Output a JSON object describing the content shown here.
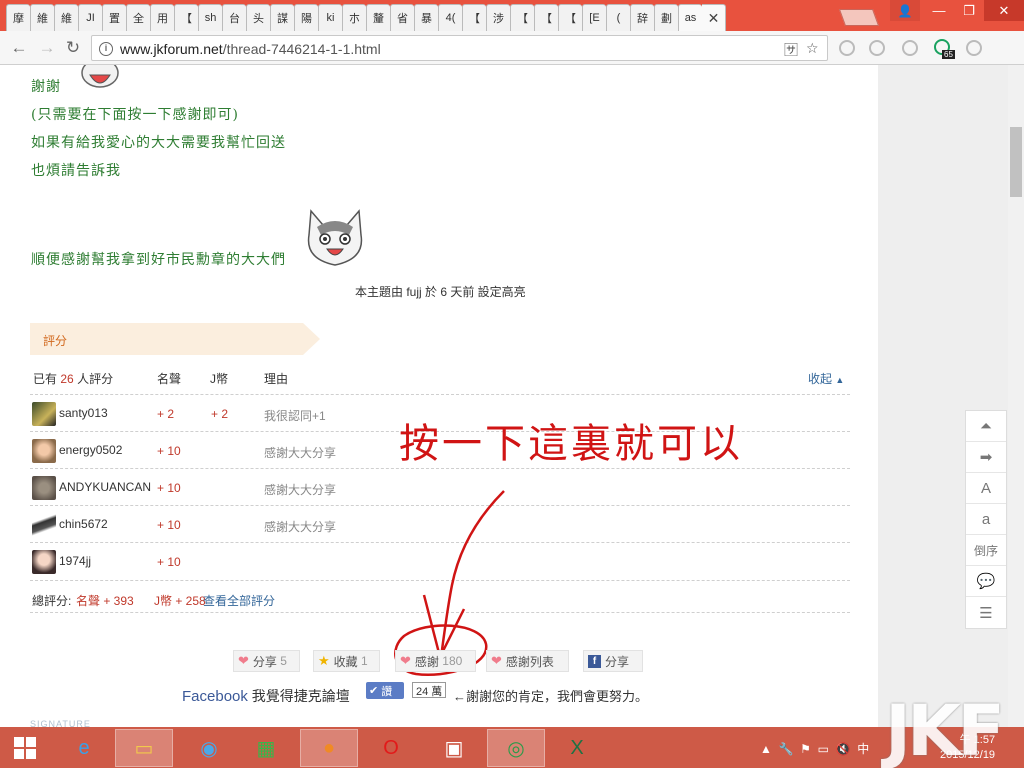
{
  "browser": {
    "tabs": [
      "摩",
      "維",
      "維",
      "JI",
      "置",
      "全",
      "用",
      "【",
      "sh",
      "台",
      "头",
      "謀",
      "陽",
      "ki",
      "朩",
      "釐",
      "省",
      "暴",
      "4(",
      "【",
      "涉",
      "【",
      "【",
      "【",
      "[E",
      "(",
      "辞",
      "劃",
      "as"
    ],
    "close_glyph": "✕",
    "url_host": "www.jkforum.net",
    "url_path": "/thread-7446214-1-1.html",
    "extension_badge": "65"
  },
  "post": {
    "line1": "謝謝",
    "line2": "(只需要在下面按一下感謝即可)",
    "line3": "如果有給我愛心的大大需要我幫忙回送",
    "line4": "也煩請告訴我",
    "line5": "順便感謝幫我拿到好市民勳章的大大們",
    "highlight_note": "本主題由 fujj 於 6 天前 設定高亮"
  },
  "rating": {
    "tab_label": "評分",
    "summary_prefix": "已有",
    "summary_count": "26",
    "summary_suffix": "人評分",
    "col_fame": "名聲",
    "col_coin": "J幣",
    "col_reason": "理由",
    "collapse_label": "收起",
    "rows": [
      {
        "user": "santy013",
        "fame": "+ 2",
        "coin": "+ 2",
        "reason": "我很認同+1"
      },
      {
        "user": "energy0502",
        "fame": "+ 10",
        "coin": "",
        "reason": "感謝大大分享"
      },
      {
        "user": "ANDYKUANCAN",
        "fame": "+ 10",
        "coin": "",
        "reason": "感謝大大分享"
      },
      {
        "user": "chin5672",
        "fame": "+ 10",
        "coin": "",
        "reason": "感謝大大分享"
      },
      {
        "user": "1974jj",
        "fame": "+ 10",
        "coin": "",
        "reason": ""
      }
    ],
    "total_label": "總評分:",
    "total_fame": "名聲 + 393",
    "total_coin": "J幣 + 258",
    "view_all": "查看全部評分"
  },
  "annotation": "按一下這裏就可以",
  "actions": {
    "share": "分享",
    "share_count": "5",
    "collect": "收藏",
    "collect_count": "1",
    "thanks": "感謝",
    "thanks_count": "180",
    "thanks_list": "感謝列表",
    "fb_share": "分享"
  },
  "facebook": {
    "brand": "Facebook",
    "text": "我覺得捷克論壇",
    "read_button": "讚",
    "count": "24 萬",
    "thanks_text": "←謝謝您的肯定，我們會更努力。"
  },
  "signature_label": "SIGNATURE",
  "side_tools": [
    "⏶",
    "➡",
    "A",
    "a",
    "倒序",
    "💬",
    "☰"
  ],
  "taskbar": {
    "clock_time": "午 1:57",
    "clock_date": "2015/12/19"
  },
  "watermark": "JKF"
}
